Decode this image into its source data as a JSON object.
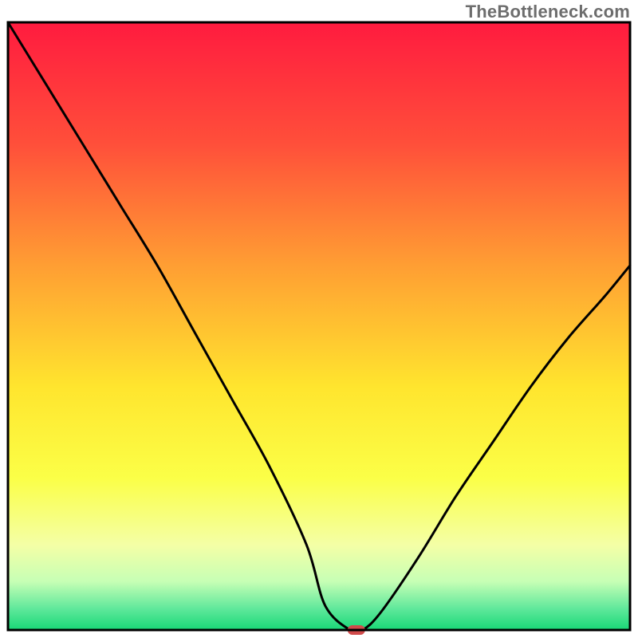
{
  "watermark": "TheBottleneck.com",
  "chart_data": {
    "type": "line",
    "title": "",
    "xlabel": "",
    "ylabel": "",
    "xlim": [
      0,
      100
    ],
    "ylim": [
      0,
      100
    ],
    "x": [
      0,
      6,
      12,
      18,
      24,
      30,
      36,
      42,
      48,
      51,
      55,
      57,
      60,
      66,
      72,
      78,
      84,
      90,
      96,
      100
    ],
    "values": [
      100,
      90,
      80,
      70,
      60,
      49,
      38,
      27,
      14,
      4,
      0,
      0,
      3,
      12,
      22,
      31,
      40,
      48,
      55,
      60
    ],
    "minimum_marker": {
      "x": 56,
      "value": 0
    },
    "gradient_stops": [
      {
        "offset": 0.0,
        "color": "#ff1b3f"
      },
      {
        "offset": 0.2,
        "color": "#ff4f3a"
      },
      {
        "offset": 0.4,
        "color": "#ff9e33"
      },
      {
        "offset": 0.6,
        "color": "#ffe52e"
      },
      {
        "offset": 0.75,
        "color": "#fbff47"
      },
      {
        "offset": 0.86,
        "color": "#f4ffa6"
      },
      {
        "offset": 0.92,
        "color": "#c7ffb5"
      },
      {
        "offset": 0.965,
        "color": "#5fe89b"
      },
      {
        "offset": 1.0,
        "color": "#18d877"
      }
    ]
  }
}
